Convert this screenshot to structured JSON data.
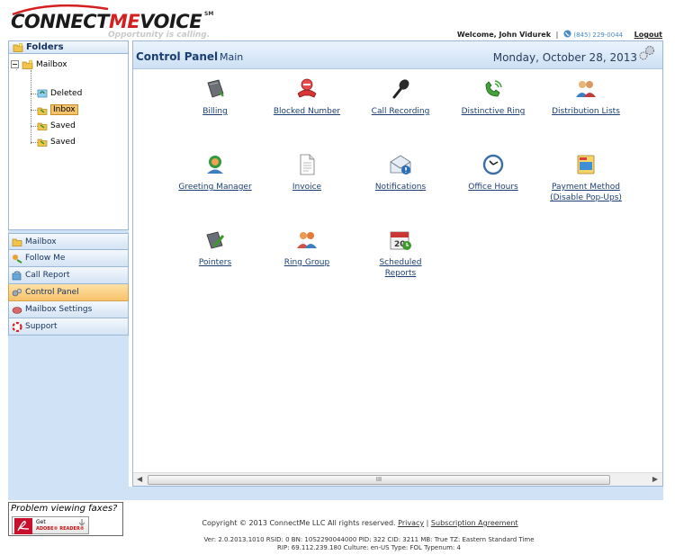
{
  "header": {
    "logo_connect": "CONNECT",
    "logo_me": "ME",
    "logo_voice": "VOICE",
    "logo_sm": "SM",
    "tagline": "Opportunity is calling.",
    "welcome": "Welcome, John Vidurek",
    "phone": "(845) 229-0044",
    "logout": "Logout"
  },
  "folders": {
    "title": "Folders",
    "root": "Mailbox",
    "items": [
      "Deleted",
      "Inbox",
      "Saved",
      "Saved"
    ],
    "selected": "Inbox"
  },
  "nav": {
    "items": [
      "Mailbox",
      "Follow Me",
      "Call Report",
      "Control Panel",
      "Mailbox Settings",
      "Support"
    ],
    "active": "Control Panel"
  },
  "main": {
    "title": "Control Panel",
    "subtitle": "Main",
    "date": "Monday, October 28, 2013",
    "items": [
      {
        "label": "Billing",
        "icon": "billing-book-icon"
      },
      {
        "label": "Blocked Number",
        "icon": "blocked-number-icon"
      },
      {
        "label": "Call Recording",
        "icon": "microphone-icon"
      },
      {
        "label": "Distinctive Ring",
        "icon": "phone-ring-icon"
      },
      {
        "label": "Distribution Lists",
        "icon": "people-group-icon"
      },
      {
        "label": "Greeting Manager",
        "icon": "greeting-person-icon"
      },
      {
        "label": "Invoice",
        "icon": "document-icon"
      },
      {
        "label": "Notifications",
        "icon": "envelope-alert-icon"
      },
      {
        "label": "Office Hours",
        "icon": "clock-icon"
      },
      {
        "label": "Payment Method\n(Disable Pop-Ups)",
        "icon": "payment-card-icon"
      },
      {
        "label": "Pointers",
        "icon": "pointer-pencil-icon"
      },
      {
        "label": "Ring Group",
        "icon": "ring-group-icon"
      },
      {
        "label": "Scheduled\nReports",
        "icon": "calendar-icon"
      }
    ],
    "scroll_grip": "III"
  },
  "footer": {
    "pdf_question": "Problem viewing faxes?",
    "pdf_get": "Get",
    "pdf_reader": "ADOBE® READER®",
    "copyright": "Copyright © 2013 ConnectMe LLC All rights reserved.",
    "privacy": "Privacy",
    "subscription": "Subscription Agreement",
    "version_line1": "Ver: 2.0.2013.1010   RSID: 0 BN: 10S2290044000 PID: 322 CID: 3211 MB: True   TZ: Eastern Standard Time",
    "version_line2": "RIP: 69.112.239.180 Culture: en-US Type: FOL Typenum: 4"
  },
  "colors": {
    "brand_red": "#d32020",
    "nav_blue": "#15325e",
    "panel_bg": "#cfe2f6",
    "active_orange": "#f7c26a"
  }
}
